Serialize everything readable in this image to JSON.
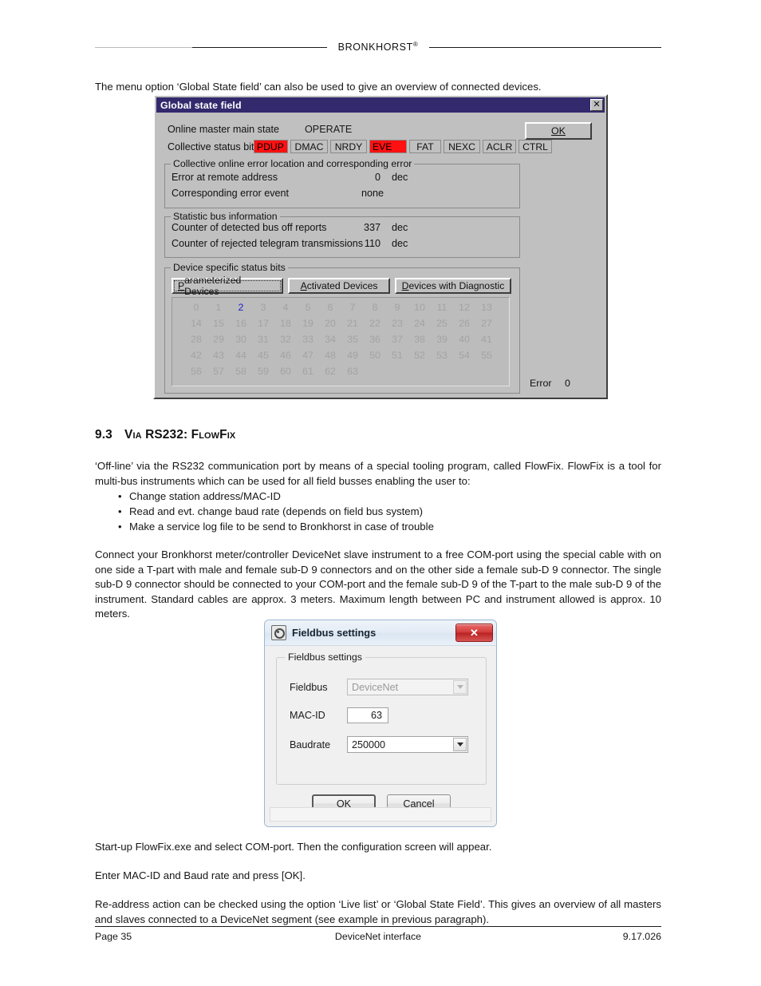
{
  "header": {
    "brand": "BRONKHORST",
    "brand_sup": "®"
  },
  "intro": "The menu option ‘Global State field’ can also be used to give an overview of connected devices.",
  "global_state_dialog": {
    "title": "Global state field",
    "close_label": "✕",
    "ok_label_pre": "",
    "ok_label": "OK",
    "main_state_label": "Online master main state",
    "main_state_value": "OPERATE",
    "status_bits_label": "Collective status bits",
    "status_bits": [
      {
        "name": "PDUP",
        "active": true
      },
      {
        "name": "DMAC",
        "active": false
      },
      {
        "name": "NRDY",
        "active": false
      },
      {
        "name": "EVE",
        "active": true
      },
      {
        "name": "FAT",
        "active": false
      },
      {
        "name": "NEXC",
        "active": false
      },
      {
        "name": "ACLR",
        "active": false
      },
      {
        "name": "CTRL",
        "active": false
      }
    ],
    "error_group": {
      "caption": "Collective online error location and corresponding error",
      "rows": [
        {
          "label": "Error at remote address",
          "value": "0",
          "unit": "dec"
        },
        {
          "label": "Corresponding error event",
          "value": "none",
          "unit": ""
        }
      ]
    },
    "stat_group": {
      "caption": "Statistic bus information",
      "rows": [
        {
          "label": "Counter of detected bus off reports",
          "value": "337",
          "unit": "dec"
        },
        {
          "label": "Counter of rejected telegram transmissions",
          "value": "110",
          "unit": "dec"
        }
      ]
    },
    "device_group": {
      "caption": "Device specific status bits",
      "buttons": [
        {
          "label": "Parameterized Devices",
          "accel": "P",
          "focused": true
        },
        {
          "label": "Activated Devices",
          "accel": "A",
          "focused": false
        },
        {
          "label": "Devices with Diagnostic",
          "accel": "D",
          "focused": false
        }
      ],
      "grid_rows": [
        [
          "0",
          "1",
          "2",
          "3",
          "4",
          "5",
          "6",
          "7",
          "8",
          "9",
          "10",
          "11",
          "12",
          "13"
        ],
        [
          "14",
          "15",
          "16",
          "17",
          "18",
          "19",
          "20",
          "21",
          "22",
          "23",
          "24",
          "25",
          "26",
          "27"
        ],
        [
          "28",
          "29",
          "30",
          "31",
          "32",
          "33",
          "34",
          "35",
          "36",
          "37",
          "38",
          "39",
          "40",
          "41"
        ],
        [
          "42",
          "43",
          "44",
          "45",
          "46",
          "47",
          "48",
          "49",
          "50",
          "51",
          "52",
          "53",
          "54",
          "55"
        ],
        [
          "56",
          "57",
          "58",
          "59",
          "60",
          "61",
          "62",
          "63"
        ]
      ],
      "highlighted": "2",
      "highlight_color": "#2222cc"
    },
    "error_counter_label": "Error",
    "error_counter_value": "0"
  },
  "section": {
    "number": "9.3",
    "title_a": "Via",
    "title_b": "RS232:",
    "title_c": "FlowFix"
  },
  "paragraph_offline": "‘Off-line’ via the RS232 communication port by means of a special tooling program, called FlowFix. FlowFix is a tool for multi-bus instruments which can be used for all field busses enabling the user to:",
  "bullets": [
    "Change station address/MAC-ID",
    "Read and evt. change baud rate (depends on field bus system)",
    "Make a service log file to be send to Bronkhorst in case of trouble"
  ],
  "paragraph_connect": "Connect your Bronkhorst meter/controller DeviceNet slave instrument to a free COM-port using the special cable with on one side a T-part with male and female sub-D 9 connectors and on the other side a female sub-D 9 connector. The single sub-D 9 connector should be connected to your COM-port and the female sub-D 9 of the T-part to the male sub-D 9 of the instrument. Standard cables are approx. 3 meters. Maximum length between PC and instrument allowed is approx. 10 meters.",
  "fieldbus_dialog": {
    "title": "Fieldbus settings",
    "close_label": "✕",
    "group_caption": "Fieldbus settings",
    "fieldbus_label": "Fieldbus",
    "fieldbus_value": "DeviceNet",
    "macid_label": "MAC-ID",
    "macid_value": "63",
    "baudrate_label": "Baudrate",
    "baudrate_value": "250000",
    "ok_label": "OK",
    "cancel_label": "Cancel"
  },
  "paragraph_startup": "Start-up FlowFix.exe and select COM-port. Then the configuration screen will appear.",
  "paragraph_enter": "Enter MAC-ID and Baud rate and press [OK].",
  "paragraph_readdress": "Re-address action can be checked using the option ‘Live list’ or ‘Global State Field’. This gives an overview of all masters and slaves connected to a DeviceNet segment (see example in previous paragraph).",
  "footer": {
    "left": "Page 35",
    "center": "DeviceNet interface",
    "right": "9.17.026"
  }
}
